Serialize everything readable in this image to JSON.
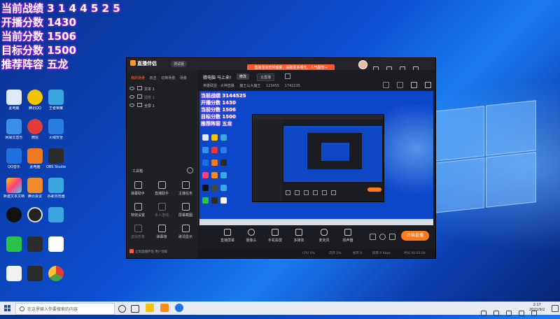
{
  "overlay": {
    "lines": [
      "当前战绩",
      "开播分数 1430",
      "当前分数 1506",
      "目标分数 1500",
      "推荐阵容 五龙"
    ],
    "record_tail": "3 1 4 4 5 2 5"
  },
  "desktop_icons": [
    "此电脑",
    "腾讯QQ",
    "王者荣耀",
    "网易云音乐",
    "微信",
    "火绒安全",
    "QQ音乐",
    "此电脑",
    "OBS Studio",
    "新建文本文档",
    "腾讯会议",
    "谷歌浏览器"
  ],
  "app": {
    "brand": "直播伴侣",
    "version": "测试版",
    "promo": "直播活动年终盛宴，赢取更多曝光，人气翻倍→",
    "sidebar_tabs": [
      "我的场景",
      "双击",
      "切换场景",
      "场景"
    ],
    "sources": [
      {
        "label": "文本 1",
        "dim": false
      },
      {
        "label": "图像 1",
        "dim": true
      },
      {
        "label": "全屏 1",
        "dim": false
      }
    ],
    "tools_title": "工具箱",
    "tools": [
      {
        "label": "弹幕助手",
        "dim": false
      },
      {
        "label": "直播助手",
        "dim": false
      },
      {
        "label": "主播任务",
        "dim": false
      },
      {
        "label": "特效设置",
        "dim": false
      },
      {
        "label": "多人连线",
        "dim": true
      },
      {
        "label": "屏幕截图",
        "dim": false
      },
      {
        "label": "虚拟形象",
        "dim": true
      },
      {
        "label": "弹幕墙",
        "dim": false
      },
      {
        "label": "歌词显示",
        "dim": false
      }
    ],
    "notice": "立刻直播伴侣 用户须知",
    "room": {
      "title": "猜电脑 马上来!",
      "tag_a": "修改",
      "tag_b": "云直播",
      "meta": [
        "英雄联盟 · 大神直播",
        "魔王山大魔王",
        "123455",
        "1742235"
      ]
    },
    "preview_overlay": [
      "当前战绩 3144525",
      "开播分数 1430",
      "当前分数 1506",
      "目标分数 1500",
      "推荐阵容 五龙"
    ],
    "controls": [
      {
        "label": "直播屏幕"
      },
      {
        "label": "摄像头"
      },
      {
        "label": "手机投屏"
      },
      {
        "label": "多媒体"
      },
      {
        "label": "麦克风"
      },
      {
        "label": "扬声器"
      }
    ],
    "start_button": "开始直播",
    "status": [
      "CPU 0%",
      "内存 1%",
      "帧率 0",
      "码率 0 Kbps",
      "时长 00:00:00"
    ]
  },
  "taskbar": {
    "search_placeholder": "在这里输入你要搜索的内容",
    "clock_time": "2:17",
    "clock_date": "2021/9/2"
  }
}
